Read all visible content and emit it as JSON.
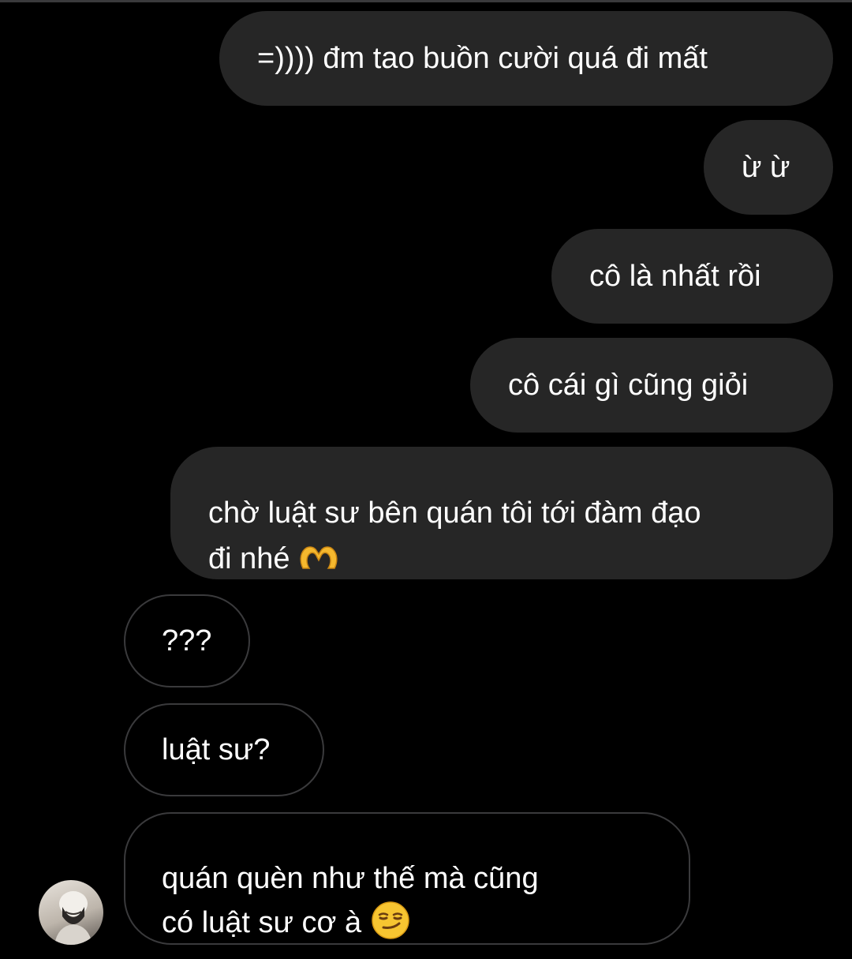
{
  "thread": {
    "messages": [
      {
        "sender": "me",
        "text": "=)))) đm tao buồn cười quá đi mất"
      },
      {
        "sender": "me",
        "text": "ừ ừ"
      },
      {
        "sender": "me",
        "text": "cô là nhất rồi"
      },
      {
        "sender": "me",
        "text": "cô cái gì cũng giỏi"
      },
      {
        "sender": "me",
        "text": "chờ luật sư bên quán tôi tới đàm đạo\nđi nhé",
        "emoji": "heart-hands-emoji"
      },
      {
        "sender": "other",
        "text": "???"
      },
      {
        "sender": "other",
        "text": "luật sư?"
      },
      {
        "sender": "other",
        "text": "quán quèn như thế mà cũng\ncó luật sư cơ à",
        "emoji": "smirk-emoji"
      }
    ]
  },
  "colors": {
    "background": "#000000",
    "sent_bubble": "#262626",
    "received_border": "#3a3a3c",
    "text": "#ffffff"
  }
}
